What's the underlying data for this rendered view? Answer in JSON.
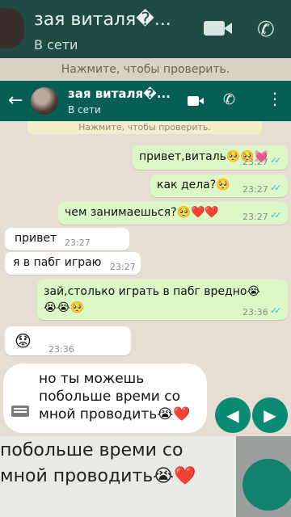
{
  "contact": {
    "name": "зая виталя�...",
    "status": "В сети"
  },
  "background_header": {
    "name": "зая виталя�...",
    "status": "В сети",
    "banner": "Нажмите, чтобы проверить."
  },
  "banner": "Нажмите, чтобы проверить.",
  "messages": [
    {
      "dir": "out",
      "text": "привет,виталь🥺🥺💓",
      "time": "23:27",
      "read": true
    },
    {
      "dir": "out",
      "text": "как дела?🥺",
      "time": "23:27",
      "read": true
    },
    {
      "dir": "out",
      "text": "чем занимаешься?🥺❤️❤️",
      "time": "23:27",
      "read": true
    },
    {
      "dir": "in",
      "text": "привет",
      "time": "23:27"
    },
    {
      "dir": "in",
      "text": "я в пабг играю",
      "time": "23:27"
    },
    {
      "dir": "out",
      "text": "зай,столько играть в пабг вредно😭\n😭😭🥺",
      "time": "23:36",
      "read": true
    },
    {
      "dir": "in",
      "text": "😟",
      "time": "23:36"
    }
  ],
  "composer": {
    "text": "но ты можешь\nпобольше времи со\nмной проводить😭❤️"
  },
  "background_footer": {
    "text": "побольше времи со\nмной проводить😭❤️"
  },
  "ticks": "✓✓",
  "icons": {
    "back": "←",
    "phone": "✆",
    "menu": "⋮",
    "prev": "◀",
    "next": "▶"
  },
  "colors": {
    "header": "#075e54",
    "outgoing": "#dcf8c6",
    "incoming": "#ffffff",
    "nav": "#0b8a73"
  }
}
